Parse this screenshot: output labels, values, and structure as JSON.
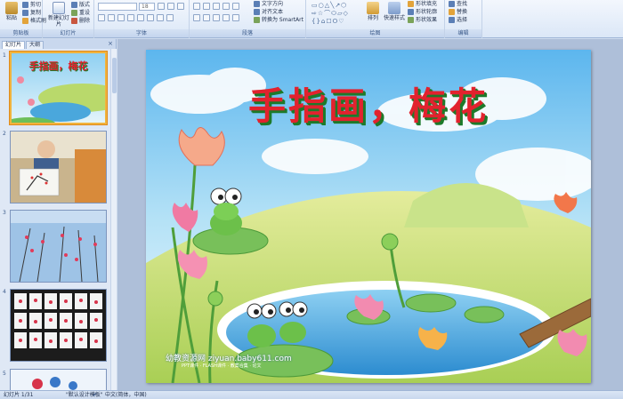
{
  "ribbon": {
    "clipboard": {
      "label": "剪贴板",
      "paste": "粘贴",
      "cut": "剪切",
      "copy": "复制",
      "format_painter": "格式刷"
    },
    "slides": {
      "label": "幻灯片",
      "new_slide": "新建幻灯片",
      "layout": "版式",
      "reset": "重设",
      "delete": "删除"
    },
    "font": {
      "label": "字体",
      "size_value": "18"
    },
    "paragraph": {
      "label": "段落",
      "text_direction": "文字方向",
      "align_text": "对齐文本",
      "smartart": "转换为 SmartArt"
    },
    "drawing": {
      "label": "绘图",
      "arrange": "排列",
      "quick_styles": "快速样式",
      "shape_fill": "形状填充",
      "shape_outline": "形状轮廓",
      "shape_effects": "形状效果"
    },
    "editing": {
      "label": "编辑",
      "find": "查找",
      "replace": "替换",
      "select": "选择"
    }
  },
  "left_pane": {
    "tabs": [
      "幻灯片",
      "大纲"
    ],
    "close": "×",
    "thumbnails": [
      {
        "num": "1",
        "title": "手指画，梅花"
      },
      {
        "num": "2"
      },
      {
        "num": "3"
      },
      {
        "num": "4"
      },
      {
        "num": "5"
      }
    ]
  },
  "slide": {
    "title": "手指画，梅花",
    "watermark": "幼教资源网 ziyuan.baby611.com",
    "watermark_sub": "PPT课件 · FLASH课件 · 教案合集 · 论文"
  },
  "status": {
    "slide_indicator": "幻灯片 1/31",
    "theme": "\"默认设计模板\"",
    "language": "中文(简体，中国)"
  },
  "colors": {
    "title_red": "#e2222e",
    "title_shadow": "#1d7a2a",
    "ribbon_bg": "#dbe7f7",
    "selection": "#f1b33c"
  }
}
